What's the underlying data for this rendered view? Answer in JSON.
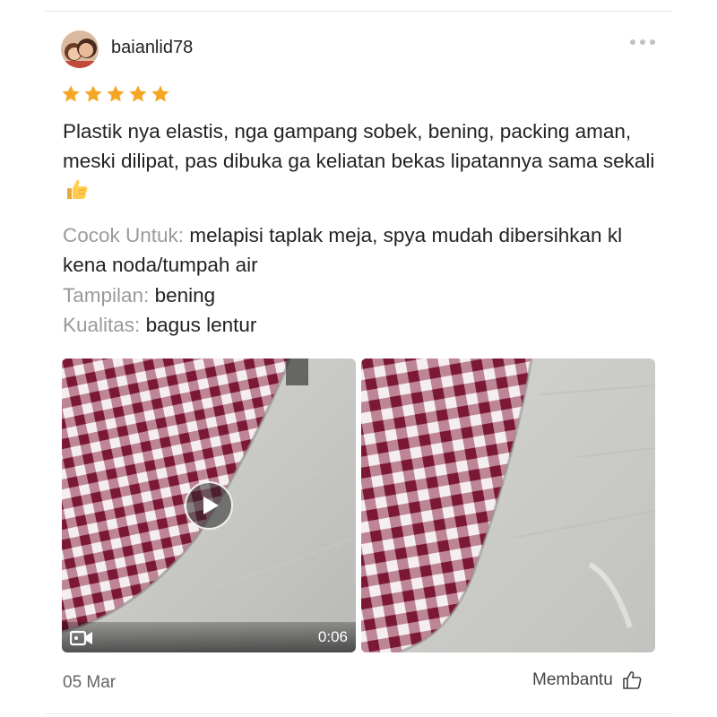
{
  "review": {
    "username": "baianlid78",
    "rating": 5,
    "max_rating": 5,
    "text": "Plastik nya elastis, nga gampang sobek, bening, packing aman, meski dilipat, pas dibuka ga keliatan bekas lipatannya sama sekali",
    "attributes": [
      {
        "label": "Cocok Untuk:",
        "value": "melapisi taplak meja, spya mudah dibersihkan kl kena noda/tumpah air"
      },
      {
        "label": "Tampilan:",
        "value": "bening"
      },
      {
        "label": "Kualitas:",
        "value": "bagus lentur"
      }
    ],
    "media": [
      {
        "type": "video",
        "duration": "0:06"
      },
      {
        "type": "image"
      }
    ],
    "date": "05 Mar",
    "helpful_label": "Membantu"
  },
  "colors": {
    "star": "#f5a623",
    "checker_dark": "#7a1836",
    "checker_light": "#f4eef0",
    "floor": "#cfcfcc"
  },
  "icons": [
    "avatar",
    "more-dots-icon",
    "star-icon",
    "thumbs-up-emoji",
    "play-icon",
    "video-camera-icon",
    "thumbs-up-outline-icon"
  ]
}
